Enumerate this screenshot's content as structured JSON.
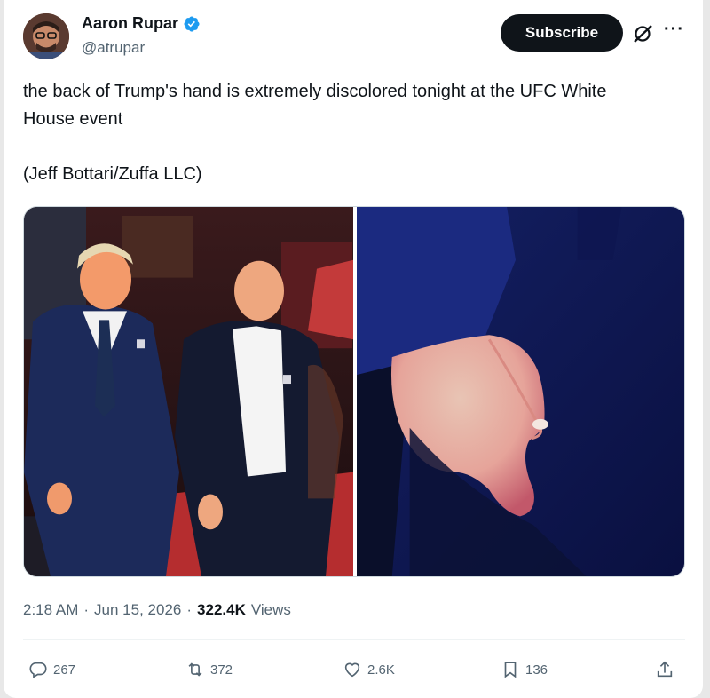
{
  "author": {
    "name": "Aaron Rupar",
    "handle": "@atrupar",
    "verified": true
  },
  "subscribe_label": "Subscribe",
  "tweet": {
    "text": "the back of Trump's hand is extremely discolored tonight at the UFC White House event\n\n(Jeff Bottari/Zuffa LLC)"
  },
  "meta": {
    "time": "2:18 AM",
    "sep1": "·",
    "date": "Jun 15, 2026",
    "sep2": "·",
    "views_count": "322.4K",
    "views_label": "Views"
  },
  "actions": {
    "replies": "267",
    "reposts": "372",
    "likes": "2.6K",
    "bookmarks": "136"
  },
  "colors": {
    "accent_blue": "#1d9bf0",
    "text_primary": "#0f1419",
    "text_secondary": "#536471"
  },
  "icons": [
    "verified-badge-icon",
    "grok-icon",
    "more-icon",
    "reply-icon",
    "repost-icon",
    "like-icon",
    "bookmark-icon",
    "share-icon"
  ]
}
